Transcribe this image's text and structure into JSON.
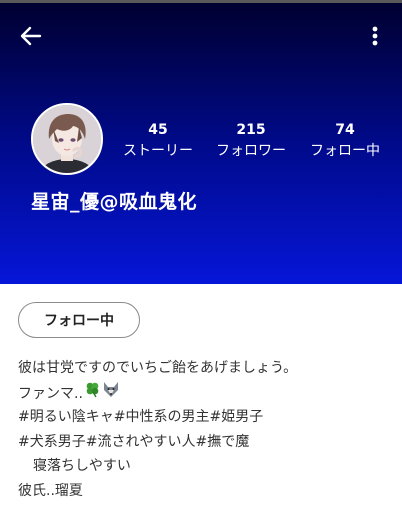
{
  "header": {
    "back_icon": "arrow-left-icon",
    "more_icon": "more-vertical-icon",
    "background_top": "#000030",
    "background_bottom": "#0616d8"
  },
  "profile": {
    "avatar": "profile-avatar",
    "display_name": "星宙_優@吸血鬼化",
    "stats": [
      {
        "value": "45",
        "label": "ストーリー"
      },
      {
        "value": "215",
        "label": "フォロワー"
      },
      {
        "value": "74",
        "label": "フォロー中"
      }
    ]
  },
  "actions": {
    "follow_label": "フォロー中"
  },
  "bio": {
    "lines": [
      "彼は甘党ですのでいちご飴をあげましょう。",
      "ファンマ..",
      "#明るい陰キャ#中性系の男主#姫男子",
      "#犬系男子#流されやすい人#撫で魔",
      "寝落ちしやすい",
      "彼氏..瑠夏"
    ],
    "fanmark_icons": [
      "four-leaf-clover-icon",
      "wolf-icon"
    ]
  }
}
